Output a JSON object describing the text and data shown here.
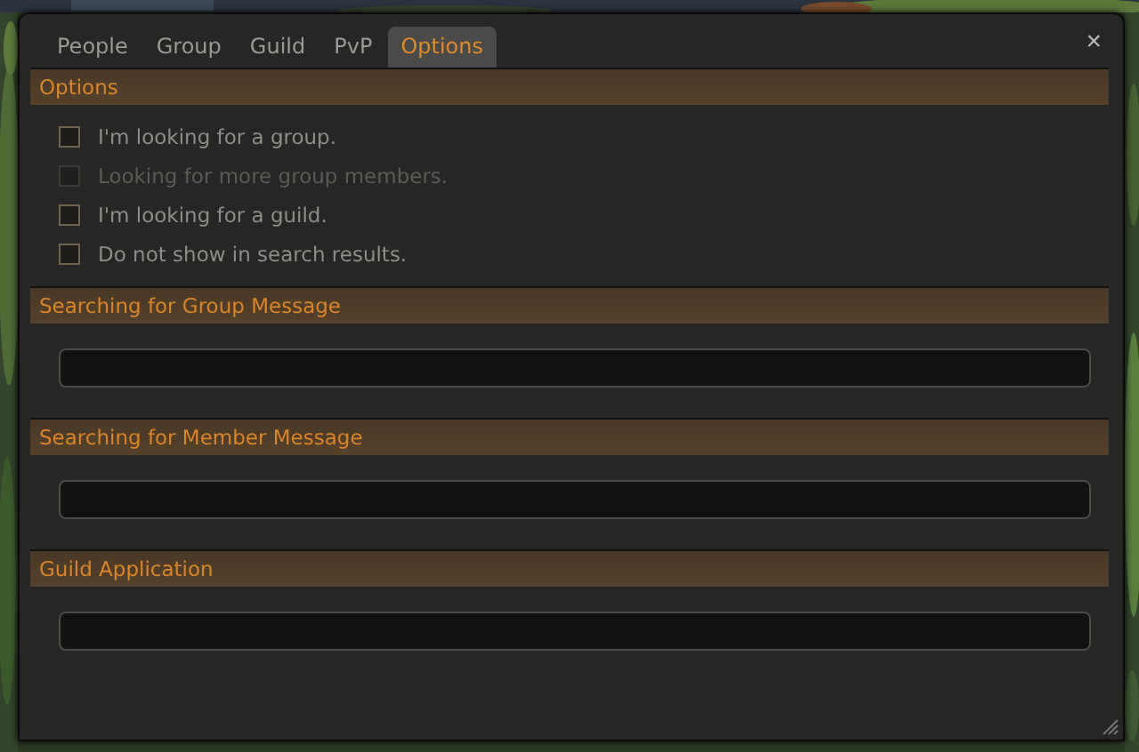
{
  "tabs": [
    {
      "label": "People",
      "selected": false
    },
    {
      "label": "Group",
      "selected": false
    },
    {
      "label": "Guild",
      "selected": false
    },
    {
      "label": "PvP",
      "selected": false
    },
    {
      "label": "Options",
      "selected": true
    }
  ],
  "close": "×",
  "options": {
    "title": "Options",
    "items": [
      {
        "label": "I'm looking for a group.",
        "checked": false,
        "disabled": false
      },
      {
        "label": "Looking for more group members.",
        "checked": false,
        "disabled": true
      },
      {
        "label": "I'm looking for a guild.",
        "checked": false,
        "disabled": false
      },
      {
        "label": "Do not show in search results.",
        "checked": false,
        "disabled": false
      }
    ]
  },
  "messages": [
    {
      "title": "Searching for Group Message"
    },
    {
      "title": "Searching for Member Message"
    },
    {
      "title": "Guild Application"
    }
  ]
}
